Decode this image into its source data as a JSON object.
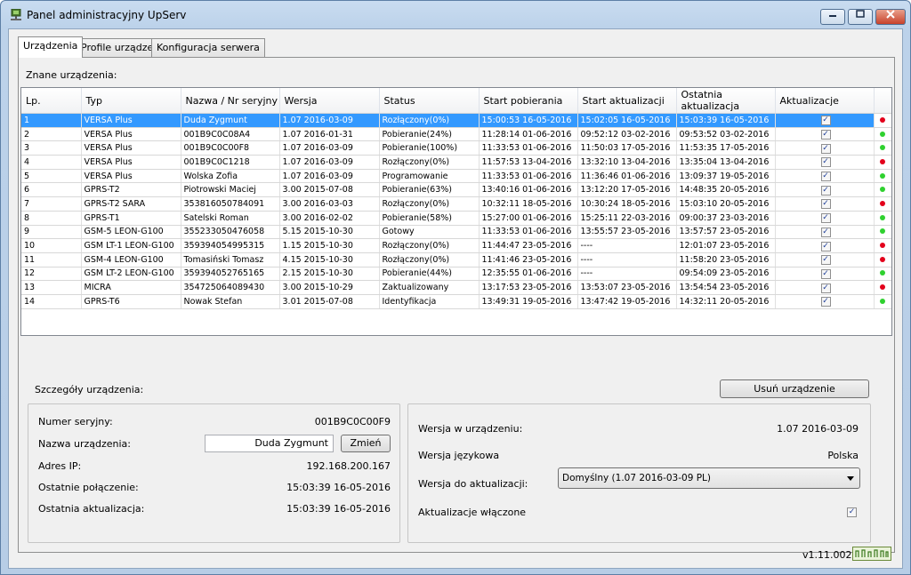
{
  "window": {
    "title": "Panel administracyjny UpServ",
    "minimize_icon": "minimize-icon",
    "maximize_icon": "maximize-icon",
    "close_icon": "close-icon"
  },
  "tabs": [
    "Urządzenia",
    "Profile urządzeń",
    "Konfiguracja serwera"
  ],
  "devices": {
    "section_label": "Znane urządzenia:",
    "columns": [
      "Lp.",
      "Typ",
      "Nazwa / Nr seryjny",
      "Wersja",
      "Status",
      "Start pobierania",
      "Start aktualizacji",
      "Ostatnia aktualizacja",
      "Aktualizacje"
    ],
    "rows": [
      {
        "lp": "1",
        "typ": "VERSA Plus",
        "nazwa": "Duda Zygmunt",
        "wersja": "1.07 2016-03-09",
        "status": "Rozłączony(0%)",
        "start_pobierania": "15:00:53 16-05-2016",
        "start_aktualizacji": "15:02:05 16-05-2016",
        "ostatnia": "15:03:39 16-05-2016",
        "dot": "red"
      },
      {
        "lp": "2",
        "typ": "VERSA Plus",
        "nazwa": "001B9C0C08A4",
        "wersja": "1.07 2016-01-31",
        "status": "Pobieranie(24%)",
        "start_pobierania": "11:28:14 01-06-2016",
        "start_aktualizacji": "09:52:12 03-02-2016",
        "ostatnia": "09:53:52 03-02-2016",
        "dot": "green"
      },
      {
        "lp": "3",
        "typ": "VERSA Plus",
        "nazwa": "001B9C0C00F8",
        "wersja": "1.07 2016-03-09",
        "status": "Pobieranie(100%)",
        "start_pobierania": "11:33:53 01-06-2016",
        "start_aktualizacji": "11:50:03 17-05-2016",
        "ostatnia": "11:53:35 17-05-2016",
        "dot": "green"
      },
      {
        "lp": "4",
        "typ": "VERSA Plus",
        "nazwa": "001B9C0C1218",
        "wersja": "1.07 2016-03-09",
        "status": "Rozłączony(0%)",
        "start_pobierania": "11:57:53 13-04-2016",
        "start_aktualizacji": "13:32:10 13-04-2016",
        "ostatnia": "13:35:04 13-04-2016",
        "dot": "red"
      },
      {
        "lp": "5",
        "typ": "VERSA Plus",
        "nazwa": "Wolska Zofia",
        "wersja": "1.07 2016-03-09",
        "status": "Programowanie",
        "start_pobierania": "11:33:53 01-06-2016",
        "start_aktualizacji": "11:36:46 01-06-2016",
        "ostatnia": "13:09:37 19-05-2016",
        "dot": "green"
      },
      {
        "lp": "6",
        "typ": "GPRS-T2",
        "nazwa": "Piotrowski Maciej",
        "wersja": "3.00 2015-07-08",
        "status": "Pobieranie(63%)",
        "start_pobierania": "13:40:16 01-06-2016",
        "start_aktualizacji": "13:12:20 17-05-2016",
        "ostatnia": "14:48:35 20-05-2016",
        "dot": "green"
      },
      {
        "lp": "7",
        "typ": "GPRS-T2 SARA",
        "nazwa": "353816050784091",
        "wersja": "3.00 2016-03-03",
        "status": "Rozłączony(0%)",
        "start_pobierania": "10:32:11 18-05-2016",
        "start_aktualizacji": "10:30:24 18-05-2016",
        "ostatnia": "15:03:10 20-05-2016",
        "dot": "red"
      },
      {
        "lp": "8",
        "typ": "GPRS-T1",
        "nazwa": "Satelski Roman",
        "wersja": "3.00 2016-02-02",
        "status": "Pobieranie(58%)",
        "start_pobierania": "15:27:00 01-06-2016",
        "start_aktualizacji": "15:25:11 22-03-2016",
        "ostatnia": "09:00:37 23-03-2016",
        "dot": "green"
      },
      {
        "lp": "9",
        "typ": "GSM-5 LEON-G100",
        "nazwa": "355233050476058",
        "wersja": "5.15 2015-10-30",
        "status": "Gotowy",
        "start_pobierania": "11:33:53 01-06-2016",
        "start_aktualizacji": "13:55:57 23-05-2016",
        "ostatnia": "13:57:57 23-05-2016",
        "dot": "green"
      },
      {
        "lp": "10",
        "typ": "GSM LT-1 LEON-G100",
        "nazwa": "359394054995315",
        "wersja": "1.15 2015-10-30",
        "status": "Rozłączony(0%)",
        "start_pobierania": "11:44:47 23-05-2016",
        "start_aktualizacji": "----",
        "ostatnia": "12:01:07 23-05-2016",
        "dot": "red"
      },
      {
        "lp": "11",
        "typ": "GSM-4 LEON-G100",
        "nazwa": "Tomasiński Tomasz",
        "wersja": "4.15 2015-10-30",
        "status": "Rozłączony(0%)",
        "start_pobierania": "11:41:46 23-05-2016",
        "start_aktualizacji": "----",
        "ostatnia": "11:58:20 23-05-2016",
        "dot": "red"
      },
      {
        "lp": "12",
        "typ": "GSM LT-2 LEON-G100",
        "nazwa": "359394052765165",
        "wersja": "2.15 2015-10-30",
        "status": "Pobieranie(44%)",
        "start_pobierania": "12:35:55 01-06-2016",
        "start_aktualizacji": "----",
        "ostatnia": "09:54:09 23-05-2016",
        "dot": "green"
      },
      {
        "lp": "13",
        "typ": "MICRA",
        "nazwa": "354725064089430",
        "wersja": "3.00 2015-10-29",
        "status": "Zaktualizowany",
        "start_pobierania": "13:17:53 23-05-2016",
        "start_aktualizacji": "13:53:07 23-05-2016",
        "ostatnia": "13:54:54 23-05-2016",
        "dot": "red"
      },
      {
        "lp": "14",
        "typ": "GPRS-T6",
        "nazwa": "Nowak Stefan",
        "wersja": "3.01 2015-07-08",
        "status": "Identyfikacja",
        "start_pobierania": "13:49:31 19-05-2016",
        "start_aktualizacji": "13:47:42 19-05-2016",
        "ostatnia": "14:32:11 20-05-2016",
        "dot": "green"
      }
    ],
    "selected_row": 0
  },
  "details": {
    "section_label": "Szczegóły urządzenia:",
    "remove_button": "Usuń urządzenie",
    "serial_label": "Numer seryjny:",
    "serial_value": "001B9C0C00F9",
    "name_label": "Nazwa urządzenia:",
    "name_value": "Duda Zygmunt",
    "change_button": "Zmień",
    "ip_label": "Adres IP:",
    "ip_value": "192.168.200.167",
    "last_conn_label": "Ostatnie połączenie:",
    "last_conn_value": "15:03:39 16-05-2016",
    "last_update_label": "Ostatnia aktualizacja:",
    "last_update_value": "15:03:39 16-05-2016",
    "version_label": "Wersja w urządzeniu:",
    "version_value": "1.07 2016-03-09",
    "lang_label": "Wersja językowa",
    "lang_value": "Polska",
    "update_version_label": "Wersja do aktualizacji:",
    "update_version_value": "Domyślny (1.07 2016-03-09 PL)",
    "updates_enabled_label": "Aktualizacje włączone"
  },
  "footer": {
    "version": "v1.11.002",
    "status_icon": "network-activity-icon"
  },
  "colors": {
    "selection": "#3399ff",
    "dot_red": "#e3001b",
    "dot_green": "#2fd12f"
  }
}
